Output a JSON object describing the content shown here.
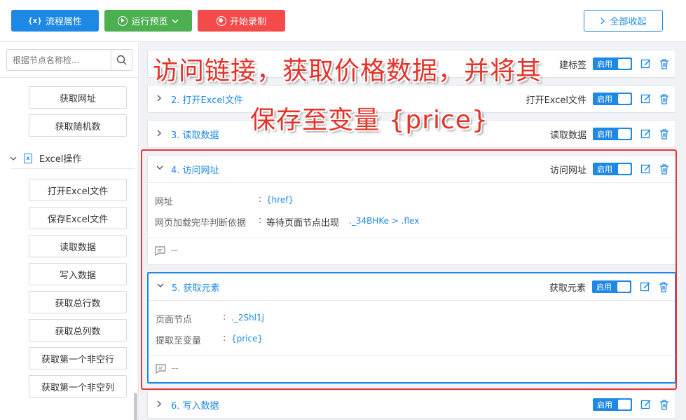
{
  "toolbar": {
    "flow_props": "流程属性",
    "run_preview": "运行预览",
    "start_record": "开始录制",
    "collapse_all": "全部收起"
  },
  "sidebar": {
    "search_placeholder": "根据节点名称检...",
    "top_items": [
      "获取网址",
      "获取随机数"
    ],
    "group_label": "Excel操作",
    "excel_items": [
      "打开Excel文件",
      "保存Excel文件",
      "读取数据",
      "写入数据",
      "获取总行数",
      "获取总列数",
      "获取第一个非空行",
      "获取第一个非空列"
    ]
  },
  "steps": [
    {
      "title": "",
      "type": "建标签",
      "toggle": "启用"
    },
    {
      "title": "2. 打开Excel文件",
      "type": "打开Excel文件",
      "toggle": "启用"
    },
    {
      "title": "3. 读取数据",
      "type": "读取数据",
      "toggle": "启用"
    },
    {
      "title": "4. 访问网址",
      "type": "访问网址",
      "toggle": "启用",
      "props": [
        {
          "label": "网址",
          "value": "{href}"
        },
        {
          "label": "网页加载完毕判断依据",
          "value_prefix": "等待页面节点出现",
          "value": "._34BHKe > .flex"
        }
      ],
      "comment": "--"
    },
    {
      "title": "5. 获取元素",
      "type": "获取元素",
      "toggle": "启用",
      "props": [
        {
          "label": "页面节点",
          "value": "._2Shl1j"
        },
        {
          "label": "提取至变量",
          "value": "{price}"
        }
      ],
      "comment": "--"
    },
    {
      "title": "6. 写入数据",
      "type": "",
      "toggle": "启用"
    }
  ],
  "annotation": {
    "line1": "访问链接，获取价格数据，并将其",
    "line2": "保存至变量 {price}"
  },
  "colors": {
    "primary": "#1e88e5",
    "green": "#4caf50",
    "red": "#f44a4a",
    "annotation": "#e5332a"
  }
}
